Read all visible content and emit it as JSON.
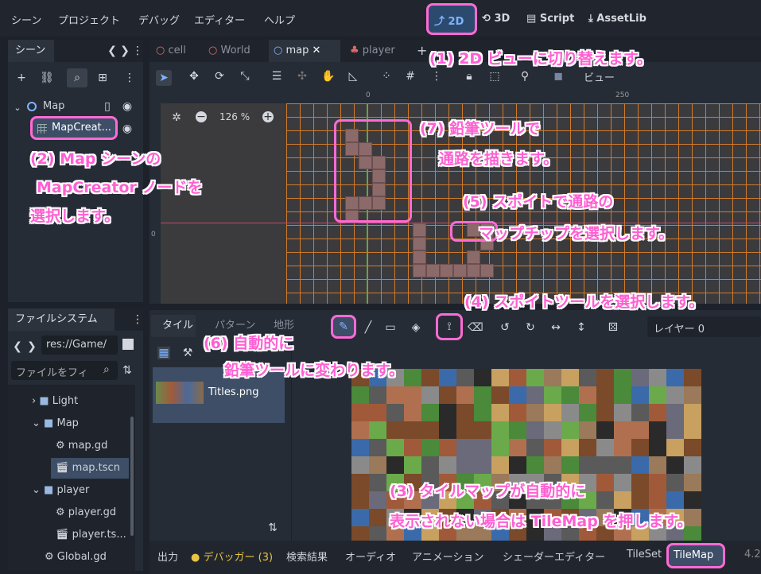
{
  "menu": {
    "items": [
      "シーン",
      "プロジェクト",
      "デバッグ",
      "エディター",
      "ヘルプ"
    ]
  },
  "modes": {
    "two_d": "2D",
    "three_d": "3D",
    "script": "Script",
    "assetlib": "AssetLib"
  },
  "scene_dock": {
    "tab_label": "シーン",
    "tree": {
      "root": "Map",
      "child": "MapCreat..."
    }
  },
  "editor_tabs": [
    "cell",
    "World",
    "map",
    "player"
  ],
  "viewport": {
    "zoom": "126 %",
    "ruler_0": "0",
    "ruler_250": "250",
    "view_menu": "ビュー",
    "ruler_left_0": "0"
  },
  "filesystem": {
    "tab_label": "ファイルシステム",
    "path": "res://Game/",
    "filter_placeholder": "ファイルをフィ",
    "rows": [
      "Light",
      "Map",
      "map.gd",
      "map.tscn",
      "player",
      "player.gd",
      "player.ts...",
      "Global.gd"
    ]
  },
  "tile_panel": {
    "tabs": [
      "タイル",
      "パターン",
      "地形"
    ],
    "layer": "レイヤー 0",
    "atlas_item": "Titles.png"
  },
  "bottom_bar": {
    "items": [
      "出力",
      "デバッガー (3)",
      "検索結果",
      "オーディオ",
      "アニメーション",
      "シェーダーエディター",
      "TileSet",
      "TileMap"
    ],
    "version": "4.2"
  },
  "callouts": {
    "c1": "(1) 2D ビューに切り替えます。",
    "c2a": "(2) Map シーンの",
    "c2b": "MapCreator ノードを",
    "c2c": "選択します。",
    "c3a": "(3) タイルマップが自動的に",
    "c3b": "表示されない場合は TileMap を押します。",
    "c4": "(4) スポイトツールを選択します。",
    "c5a": "(5) スポイトで通路の",
    "c5b": "マップチップを選択します。",
    "c6a": "(6) 自動的に",
    "c6b": "鉛筆ツールに変わります。",
    "c7a": "(7) 鉛筆ツールで",
    "c7b": "通路を描きます。"
  },
  "colors": {
    "accent": "#ff5fd2",
    "grid": "#d07a2c",
    "panel": "#262c36",
    "selected": "#3d4e66"
  }
}
